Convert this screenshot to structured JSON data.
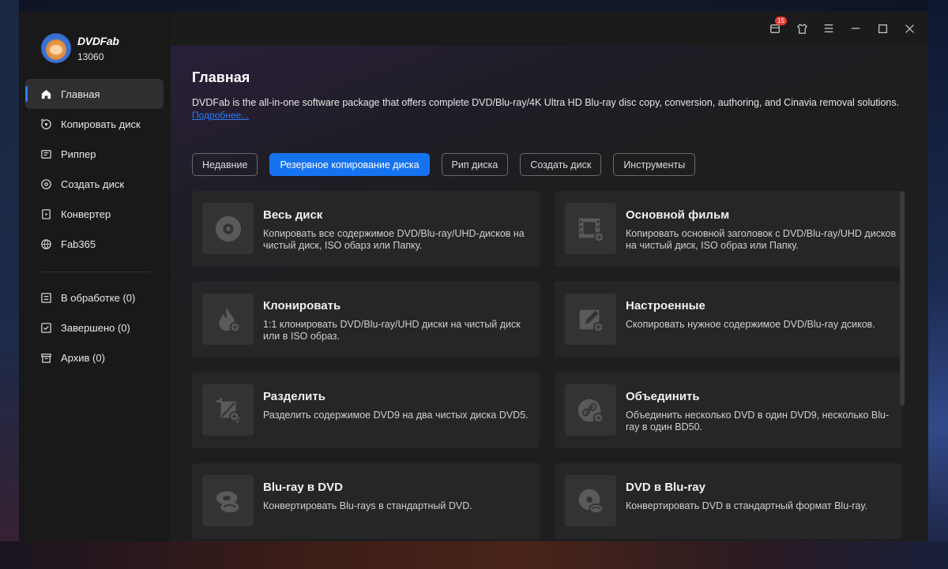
{
  "app": {
    "brand_name": "DVDFab",
    "version": "13060",
    "notification_count": "15"
  },
  "sidebar": {
    "items": [
      {
        "label": "Главная",
        "icon": "home-icon"
      },
      {
        "label": "Копировать диск",
        "icon": "copy-disc-icon"
      },
      {
        "label": "Риппер",
        "icon": "ripper-icon"
      },
      {
        "label": "Создать диск",
        "icon": "create-disc-icon"
      },
      {
        "label": "Конвертер",
        "icon": "converter-icon"
      },
      {
        "label": "Fab365",
        "icon": "fab365-icon"
      }
    ],
    "queue": [
      {
        "label": "В обработке (0)",
        "icon": "processing-icon"
      },
      {
        "label": "Завершено (0)",
        "icon": "completed-icon"
      },
      {
        "label": "Архив (0)",
        "icon": "archive-icon"
      }
    ]
  },
  "main": {
    "title": "Главная",
    "description": "DVDFab is the all-in-one software package that offers complete DVD/Blu-ray/4K Ultra HD Blu-ray disc copy, conversion, authoring, and Cinavia removal solutions.",
    "more_link": "Подробнее...",
    "tabs": [
      {
        "label": "Недавние"
      },
      {
        "label": "Резервное копирование диска"
      },
      {
        "label": "Рип диска"
      },
      {
        "label": "Создать диск"
      },
      {
        "label": "Инструменты"
      }
    ],
    "cards": [
      {
        "title": "Весь диск",
        "desc": "Копировать все содержимое DVD/Blu-ray/UHD-дисков на чистый диск, ISO обарз или Папку.",
        "icon": "disc-icon"
      },
      {
        "title": "Основной фильм",
        "desc": "Копировать основной заголовок с DVD/Blu-ray/UHD дисков на чистый диск, ISO образ или Папку.",
        "icon": "film-icon"
      },
      {
        "title": "Клонировать",
        "desc": "1:1 клонировать DVD/Blu-ray/UHD диски на чистый диск или в ISO образ.",
        "icon": "flame-icon"
      },
      {
        "title": "Настроенные",
        "desc": "Скопировать нужное содержимое DVD/Blu-ray дсиков.",
        "icon": "edit-icon"
      },
      {
        "title": "Разделить",
        "desc": "Разделить содержимое DVD9 на два чистых диска DVD5.",
        "icon": "split-icon"
      },
      {
        "title": "Объединить",
        "desc": "Объединить несколько DVD в один DVD9, несколько Blu-ray в один BD50.",
        "icon": "merge-link-icon"
      },
      {
        "title": "Blu-ray в DVD",
        "desc": "Конвертировать Blu-rays в стандартный DVD.",
        "icon": "bluray-to-dvd-icon"
      },
      {
        "title": "DVD в Blu-ray",
        "desc": "Конвертировать DVD в стандартный формат Blu-ray.",
        "icon": "dvd-to-bluray-icon"
      }
    ]
  },
  "colors": {
    "accent": "#1673f0",
    "link": "#2a7cf6",
    "badge": "#e53935"
  }
}
